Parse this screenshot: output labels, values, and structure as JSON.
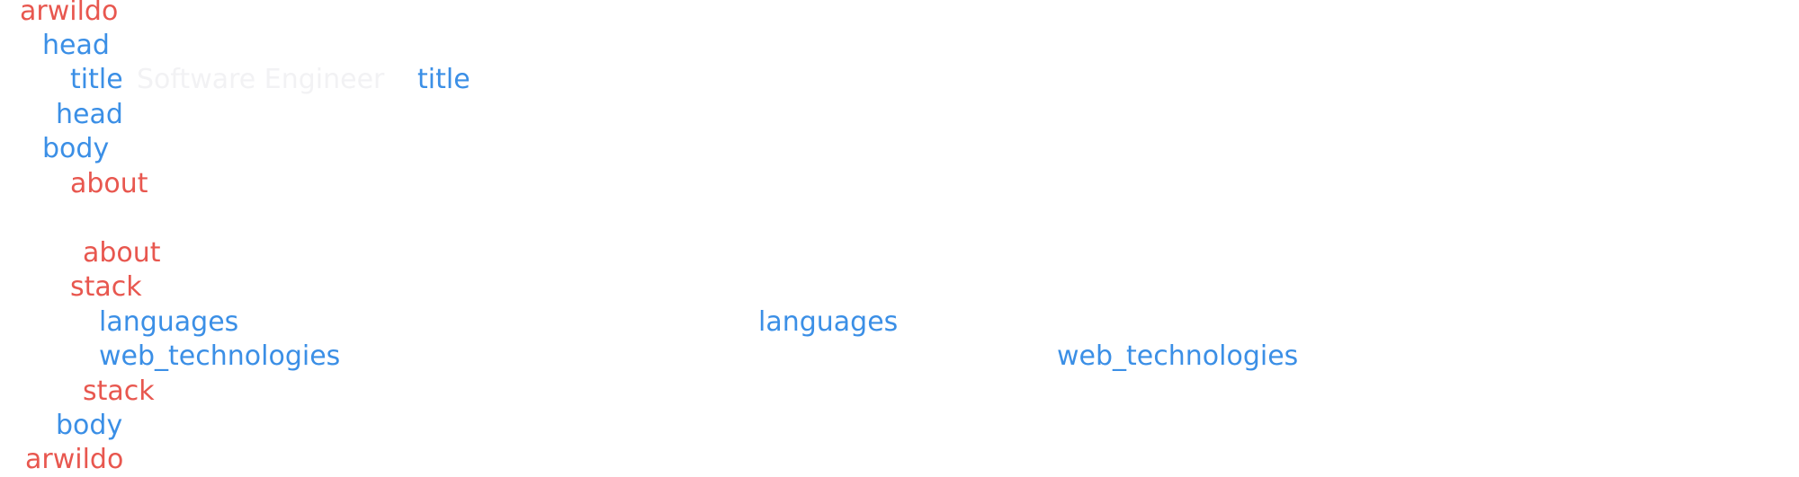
{
  "lines": [
    {
      "indent": 0,
      "tokens": [
        {
          "text": "arwildo",
          "color": "#e8574f"
        }
      ]
    },
    {
      "indent": 1,
      "tokens": [
        {
          "text": "head",
          "color": "#3b8fe6"
        }
      ]
    },
    {
      "indent": 2,
      "tokens": [
        {
          "text": "title",
          "color": "#3b8fe6"
        },
        {
          "text": "Software Engineer",
          "color": "#f2f2f4"
        },
        {
          "text": "title",
          "color": "#3b8fe6"
        }
      ]
    },
    {
      "indent": 1,
      "tokens": [
        {
          "text": "head",
          "color": "#3b8fe6"
        }
      ]
    },
    {
      "indent": 1,
      "tokens": [
        {
          "text": "body",
          "color": "#3b8fe6"
        }
      ]
    },
    {
      "indent": 2,
      "tokens": [
        {
          "text": "about",
          "color": "#e8574f"
        }
      ]
    },
    {
      "indent": 2,
      "tokens": [
        {
          "text": "about",
          "color": "#e8574f"
        }
      ]
    },
    {
      "indent": 2,
      "tokens": [
        {
          "text": "stack",
          "color": "#e8574f"
        }
      ]
    },
    {
      "indent": 3,
      "tokens": [
        {
          "text": "languages",
          "color": "#3b8fe6"
        },
        {
          "text": "languages",
          "color": "#3b8fe6"
        }
      ]
    },
    {
      "indent": 3,
      "tokens": [
        {
          "text": "web_technologies",
          "color": "#3b8fe6"
        },
        {
          "text": "web_technologies",
          "color": "#3b8fe6"
        }
      ]
    },
    {
      "indent": 2,
      "tokens": [
        {
          "text": "stack",
          "color": "#e8574f"
        }
      ]
    },
    {
      "indent": 1,
      "tokens": [
        {
          "text": "body",
          "color": "#3b8fe6"
        }
      ]
    },
    {
      "indent": 0,
      "tokens": [
        {
          "text": "arwildo",
          "color": "#e8574f"
        }
      ]
    }
  ],
  "colors": {
    "tag_primary": "#e8574f",
    "tag_secondary": "#3b8fe6",
    "hidden_text": "#f2f2f4",
    "background": "#ffffff"
  }
}
